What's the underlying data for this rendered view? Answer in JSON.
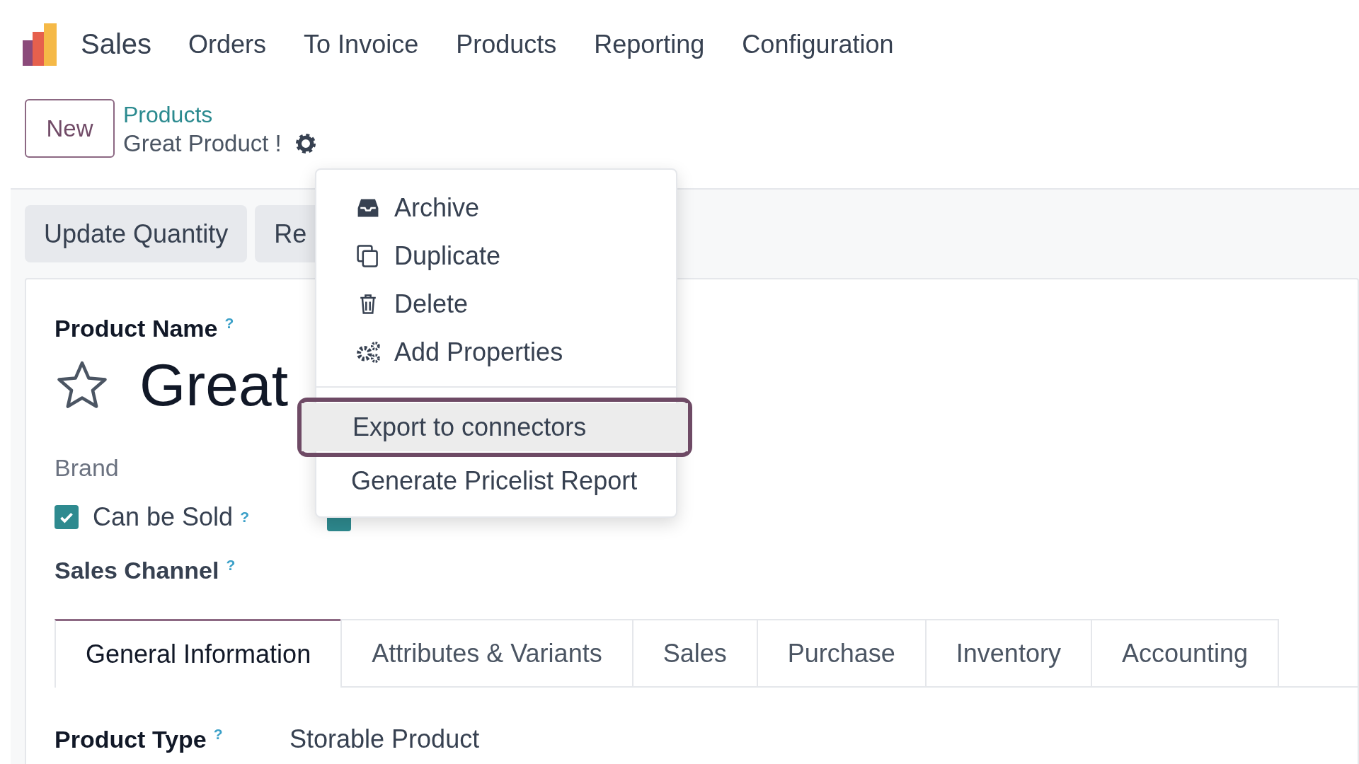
{
  "app": {
    "name": "Sales"
  },
  "nav": [
    "Orders",
    "To Invoice",
    "Products",
    "Reporting",
    "Configuration"
  ],
  "control_panel": {
    "new_button": "New",
    "breadcrumb": {
      "parent": "Products",
      "current": "Great Product !"
    }
  },
  "action_buttons": [
    "Update Quantity",
    "Re"
  ],
  "actions_menu": {
    "items": [
      {
        "label": "Archive",
        "selected": false
      },
      {
        "label": "Duplicate",
        "selected": false
      },
      {
        "label": "Delete",
        "selected": false
      },
      {
        "label": "Add Properties",
        "selected": false
      }
    ],
    "extra_items": [
      {
        "label": "Export to connectors",
        "selected": true
      },
      {
        "label": "Generate Pricelist Report",
        "selected": false
      }
    ]
  },
  "form": {
    "name_label": "Product Name",
    "name_help": "?",
    "favorite": false,
    "name": "Great",
    "brand_label": "Brand",
    "can_be_sold": {
      "label": "Can be Sold",
      "help": "?",
      "checked": true
    },
    "can_be_purchased": {
      "checked": true
    },
    "sales_channel": {
      "label": "Sales Channel",
      "help": "?"
    },
    "tabs": [
      {
        "label": "General Information",
        "selected": true
      },
      {
        "label": "Attributes & Variants",
        "selected": false
      },
      {
        "label": "Sales",
        "selected": false
      },
      {
        "label": "Purchase",
        "selected": false
      },
      {
        "label": "Inventory",
        "selected": false
      },
      {
        "label": "Accounting",
        "selected": false
      }
    ],
    "product_type": {
      "label": "Product Type",
      "help": "?",
      "value": "Storable Product"
    }
  }
}
